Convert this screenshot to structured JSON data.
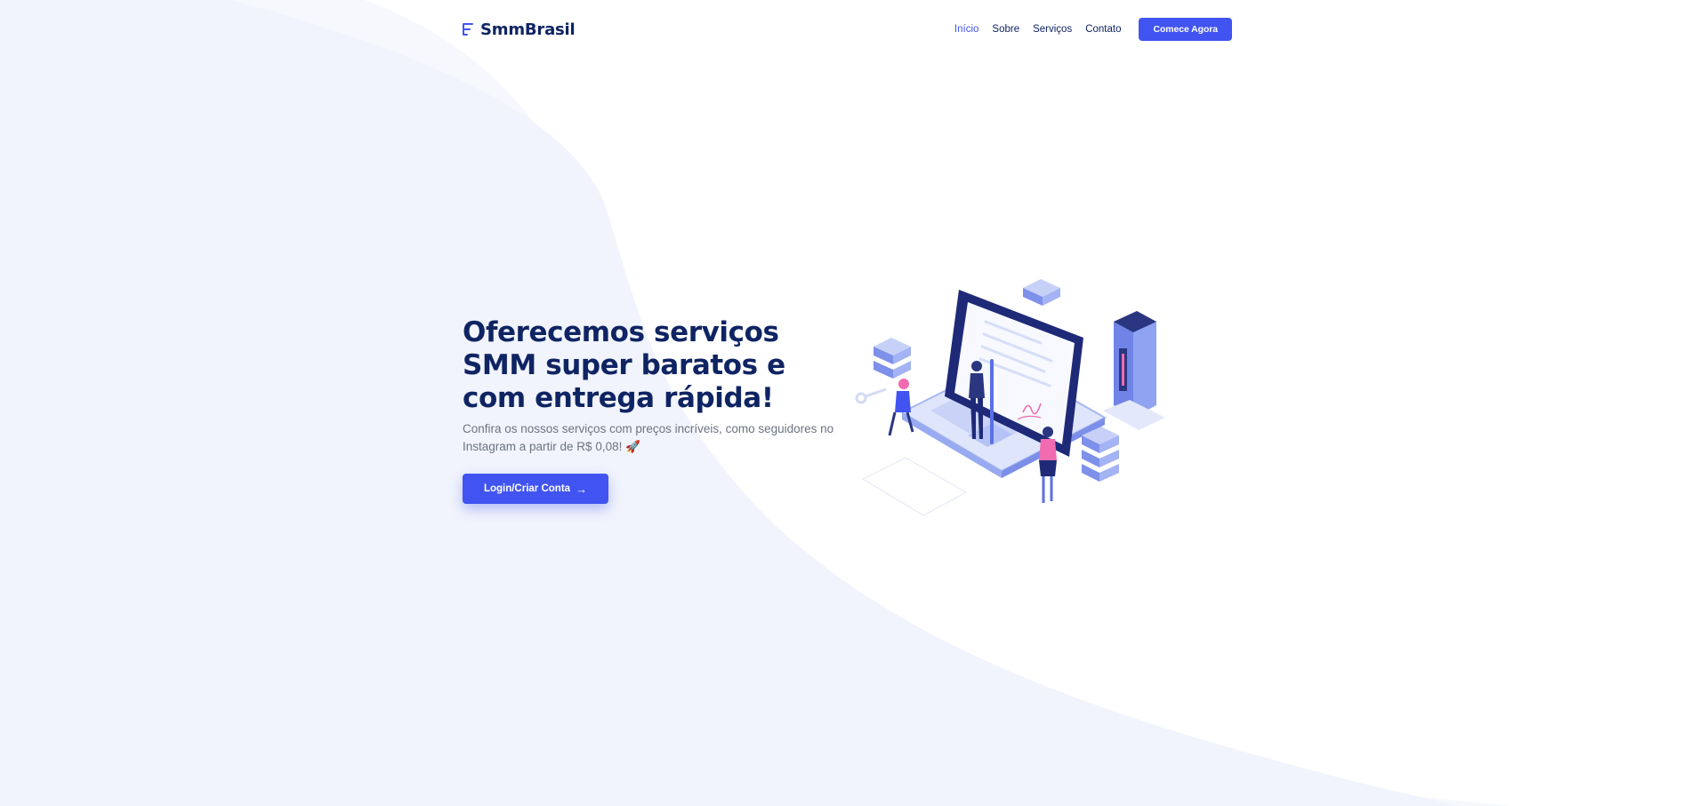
{
  "header": {
    "brand": "SmmBrasil",
    "brand_icon": "menu-lines-icon",
    "nav": [
      {
        "label": "Início",
        "active": true
      },
      {
        "label": "Sobre",
        "active": false
      },
      {
        "label": "Serviços",
        "active": false
      },
      {
        "label": "Contato",
        "active": false
      }
    ],
    "cta_label": "Comece Agora"
  },
  "hero": {
    "title": "Oferecemos serviços SMM super baratos e com entrega rápida!",
    "subtitle": "Confira os nossos serviços com preços incríveis, como seguidores no Instagram a partir de R$ 0,08! 🚀",
    "button_label": "Login/Criar Conta",
    "button_icon": "arrow-right-icon",
    "illustration": "isometric-laptop-illustration"
  },
  "colors": {
    "accent": "#4154f1",
    "navy": "#0f2463",
    "muted_text": "#6b7381",
    "wave_light": "#f1f4fc",
    "wave_lighter": "#f6f8fd"
  }
}
